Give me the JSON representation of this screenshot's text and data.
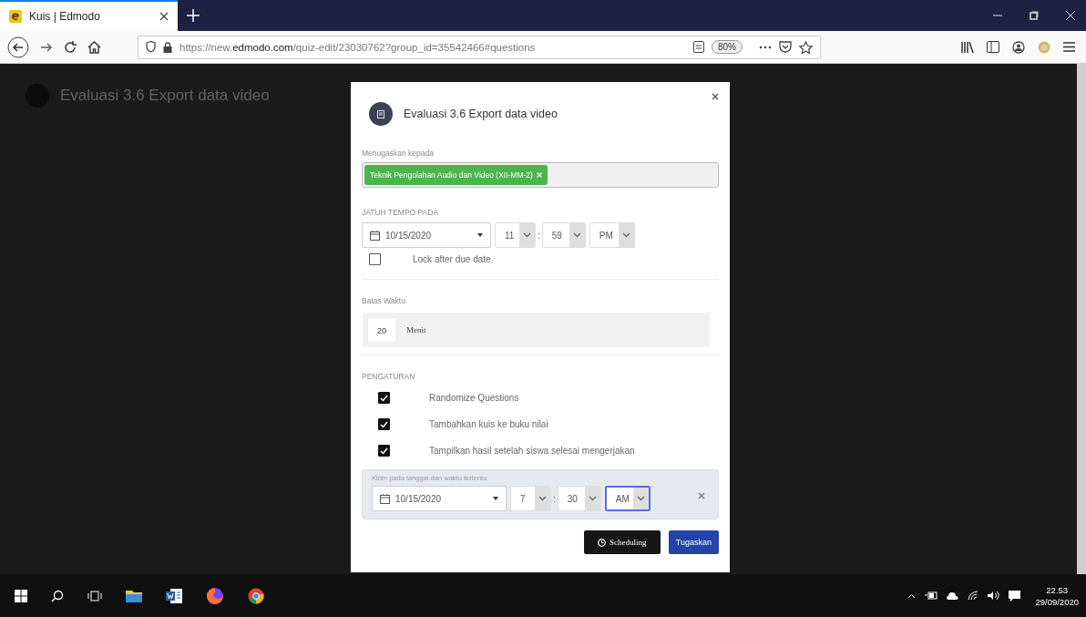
{
  "browser": {
    "tab": {
      "title": "Kuis | Edmodo",
      "selected": true
    },
    "url": "https://new.**edmodo.com**/quiz-edit/23030762?group_id=35542466#questions",
    "zoom": "80%"
  },
  "page": {
    "title": "Evaluasi 3.6 Export data video"
  },
  "dialog": {
    "title": "Evaluasi 3.6 Export data video",
    "assign_label": "Menugaskan kepada",
    "assignees": [
      {
        "label": "Teknik Pengolahan Audio dan Video (XII-MM-2)"
      }
    ],
    "due": {
      "label": "JATUH TEMPO PADA",
      "date": "10/15/2020",
      "separator": ":",
      "hour": {
        "value": "11",
        "focused": false
      },
      "minute": {
        "value": "59",
        "focused": false
      },
      "ampm": {
        "value": "PM",
        "focused": false
      },
      "lock": {
        "label": "Lock after due date",
        "checked": false
      }
    },
    "time_limit": {
      "label": "Batas Waktu",
      "value": "20",
      "unit": "Menit"
    },
    "settings": {
      "label": "PENGATURAN",
      "options": [
        {
          "label": "Randomize Questions",
          "checked": true
        },
        {
          "label": "Tambahkan kuis ke buku nilai",
          "checked": true
        },
        {
          "label": "Tampilkan hasil setelah siswa selesai mengerjakan",
          "checked": true
        }
      ]
    },
    "schedule": {
      "label": "Kirim pada tanggal dan waktu tertentu",
      "date": "10/15/2020",
      "separator": ":",
      "hour": {
        "value": "7",
        "focused": false
      },
      "minute": {
        "value": "30",
        "focused": false
      },
      "ampm": {
        "value": "AM",
        "focused": true
      }
    },
    "buttons": [
      {
        "label": "Scheduling",
        "kind": "schedule"
      },
      {
        "label": "Tugaskan",
        "kind": "primary"
      }
    ]
  },
  "taskbar": {
    "time": "22.53",
    "date": "29/09/2020"
  }
}
